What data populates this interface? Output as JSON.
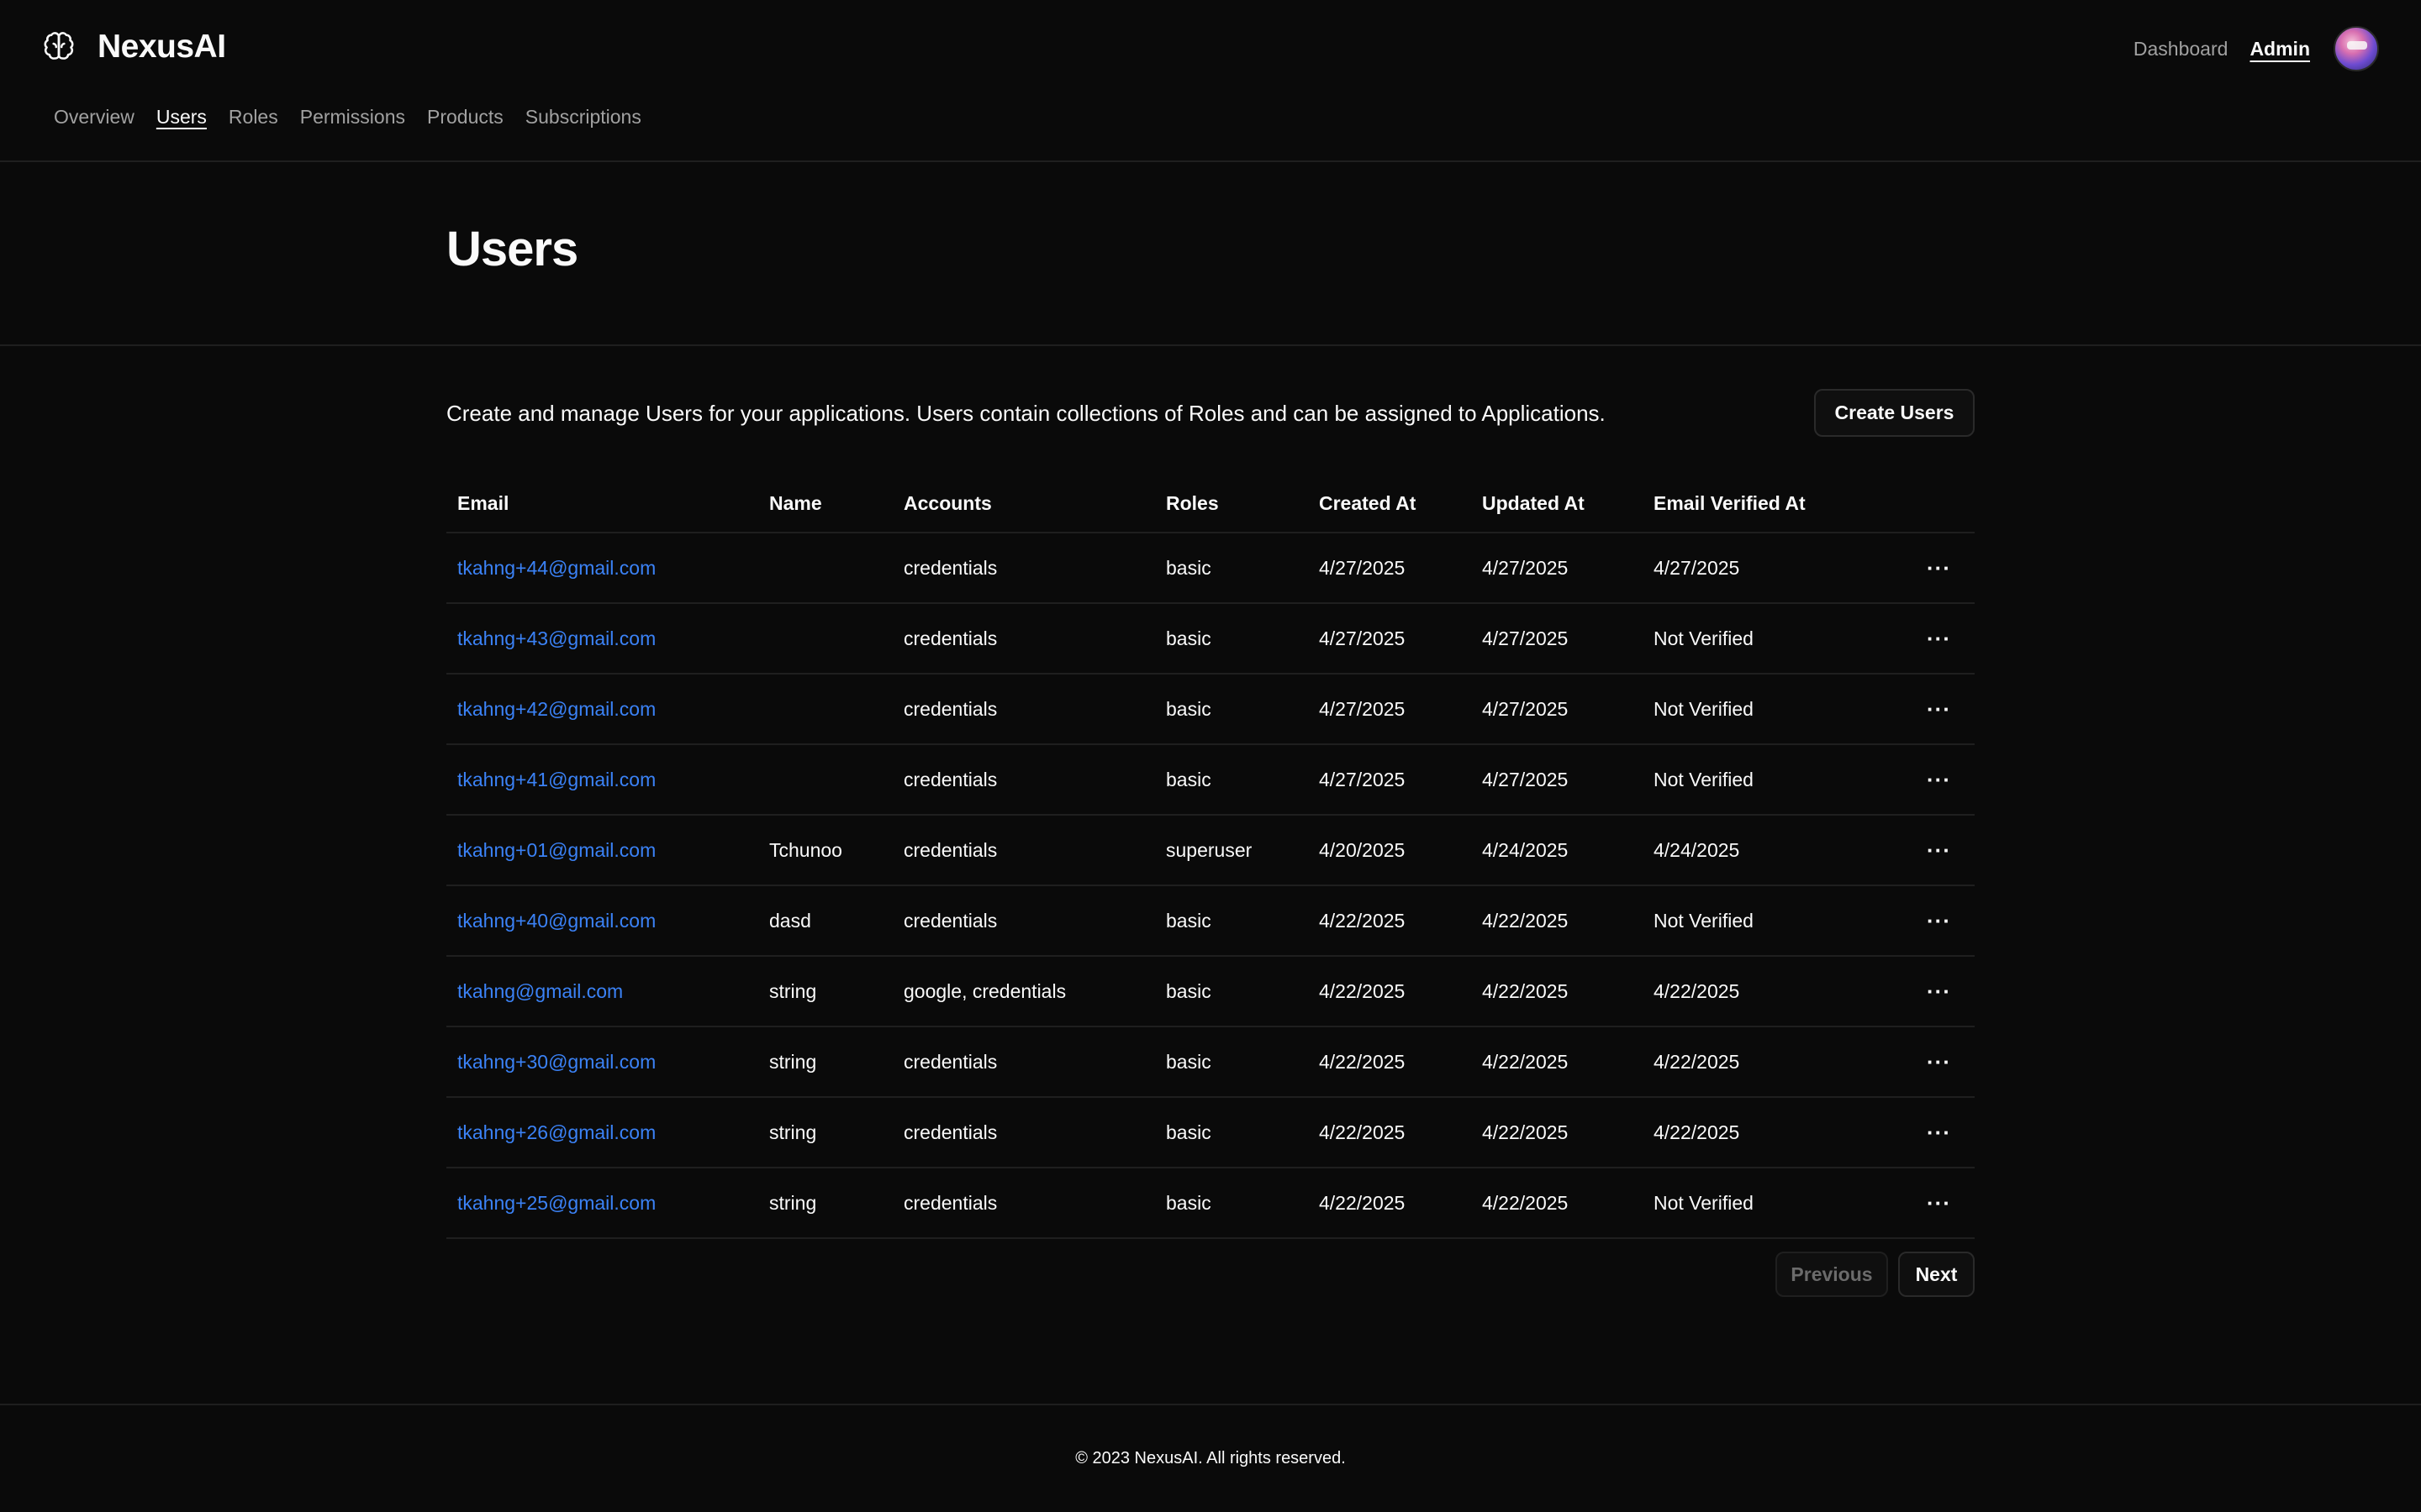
{
  "brand": {
    "name": "NexusAI",
    "icon": "brain-icon"
  },
  "top_nav": {
    "dashboard": "Dashboard",
    "admin": "Admin"
  },
  "sub_nav": [
    "Overview",
    "Users",
    "Roles",
    "Permissions",
    "Products",
    "Subscriptions"
  ],
  "active_sub_nav": "Users",
  "page": {
    "title": "Users",
    "description": "Create and manage Users for your applications. Users contain collections of Roles and can be assigned to Applications.",
    "create_button": "Create Users"
  },
  "table": {
    "columns": [
      "Email",
      "Name",
      "Accounts",
      "Roles",
      "Created At",
      "Updated At",
      "Email Verified At"
    ],
    "rows": [
      {
        "email": "tkahng+44@gmail.com",
        "name": "",
        "accounts": "credentials",
        "roles": "basic",
        "created": "4/27/2025",
        "updated": "4/27/2025",
        "verified": "4/27/2025"
      },
      {
        "email": "tkahng+43@gmail.com",
        "name": "",
        "accounts": "credentials",
        "roles": "basic",
        "created": "4/27/2025",
        "updated": "4/27/2025",
        "verified": "Not Verified"
      },
      {
        "email": "tkahng+42@gmail.com",
        "name": "",
        "accounts": "credentials",
        "roles": "basic",
        "created": "4/27/2025",
        "updated": "4/27/2025",
        "verified": "Not Verified"
      },
      {
        "email": "tkahng+41@gmail.com",
        "name": "",
        "accounts": "credentials",
        "roles": "basic",
        "created": "4/27/2025",
        "updated": "4/27/2025",
        "verified": "Not Verified"
      },
      {
        "email": "tkahng+01@gmail.com",
        "name": "Tchunoo",
        "accounts": "credentials",
        "roles": "superuser",
        "created": "4/20/2025",
        "updated": "4/24/2025",
        "verified": "4/24/2025"
      },
      {
        "email": "tkahng+40@gmail.com",
        "name": "dasd",
        "accounts": "credentials",
        "roles": "basic",
        "created": "4/22/2025",
        "updated": "4/22/2025",
        "verified": "Not Verified"
      },
      {
        "email": "tkahng@gmail.com",
        "name": "string",
        "accounts": "google, credentials",
        "roles": "basic",
        "created": "4/22/2025",
        "updated": "4/22/2025",
        "verified": "4/22/2025"
      },
      {
        "email": "tkahng+30@gmail.com",
        "name": "string",
        "accounts": "credentials",
        "roles": "basic",
        "created": "4/22/2025",
        "updated": "4/22/2025",
        "verified": "4/22/2025"
      },
      {
        "email": "tkahng+26@gmail.com",
        "name": "string",
        "accounts": "credentials",
        "roles": "basic",
        "created": "4/22/2025",
        "updated": "4/22/2025",
        "verified": "4/22/2025"
      },
      {
        "email": "tkahng+25@gmail.com",
        "name": "string",
        "accounts": "credentials",
        "roles": "basic",
        "created": "4/22/2025",
        "updated": "4/22/2025",
        "verified": "Not Verified"
      }
    ],
    "row_menu_label": "···"
  },
  "pagination": {
    "previous": "Previous",
    "next": "Next"
  },
  "footer": {
    "text": "© 2023 NexusAI. All rights reserved."
  },
  "colors": {
    "background": "#0a0a0a",
    "link": "#3b82f6",
    "border": "#1f1f1f"
  }
}
